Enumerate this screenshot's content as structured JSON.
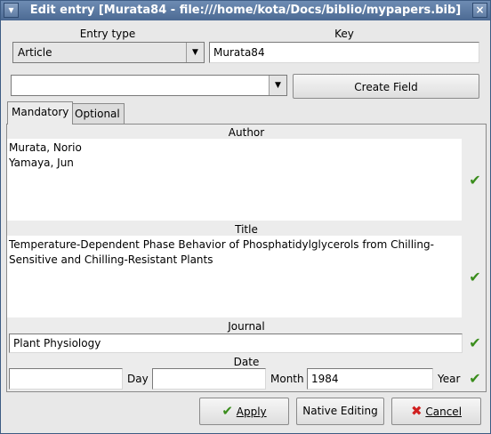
{
  "window": {
    "title": "Edit entry [Murata84 - file:///home/kota/Docs/biblio/mypapers.bib]"
  },
  "entry_type": {
    "label": "Entry type",
    "value": "Article"
  },
  "key": {
    "label": "Key",
    "value": "Murata84"
  },
  "field_combo": {
    "value": ""
  },
  "create_field_label": "Create Field",
  "tabs": [
    {
      "label": "Mandatory"
    },
    {
      "label": "Optional"
    }
  ],
  "fields": {
    "author": {
      "label": "Author",
      "value": "Murata, Norio\nYamaya, Jun"
    },
    "title": {
      "label": "Title",
      "value": "Temperature-Dependent Phase Behavior of Phosphatidylglycerols from Chilling-\nSensitive and Chilling-Resistant Plants"
    },
    "journal": {
      "label": "Journal",
      "value": "Plant Physiology"
    },
    "date": {
      "label": "Date",
      "day_label": "Day",
      "day_value": "",
      "month_label": "Month",
      "month_value": "",
      "year_label": "Year",
      "year_value": "1984"
    }
  },
  "buttons": {
    "apply": "Apply",
    "native_editing": "Native Editing",
    "cancel": "Cancel"
  },
  "colors": {
    "titlebar": "#5a789f",
    "check": "#3a8d1c",
    "cancel_icon": "#d02020"
  }
}
